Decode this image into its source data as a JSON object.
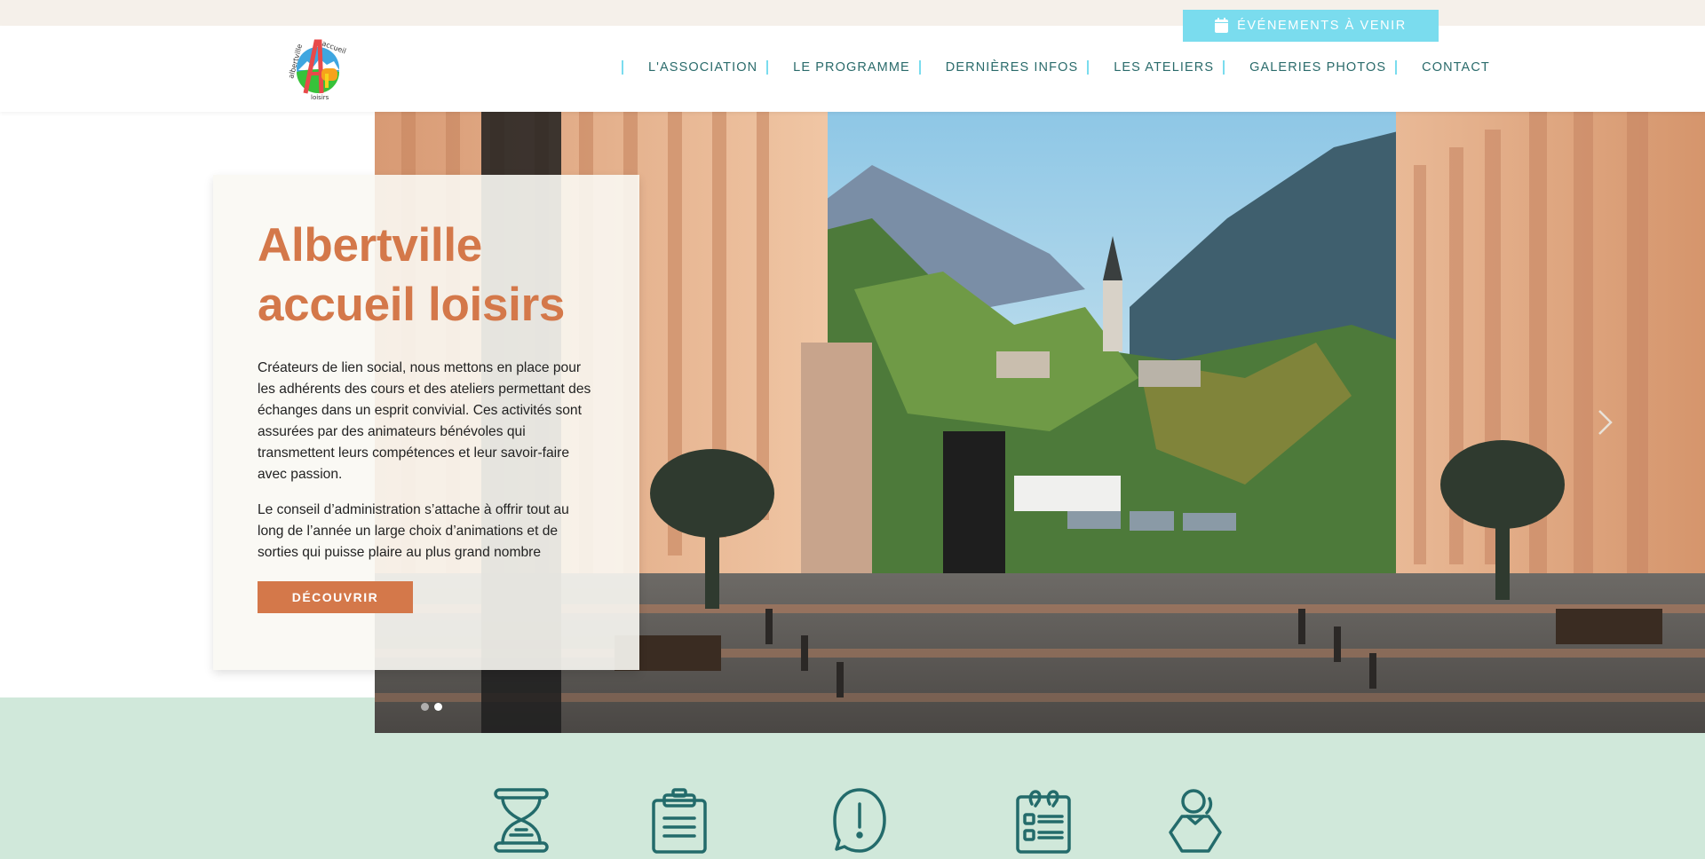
{
  "topbar": {
    "events_button": {
      "label": "Événements à venir",
      "icon": "calendar-icon"
    }
  },
  "header": {
    "logo": {
      "alt": "Albertville accueil loisirs",
      "text_top": "accueil",
      "text_left": "albertville",
      "text_bottom": "loisirs"
    },
    "nav": [
      {
        "label": "L'Association"
      },
      {
        "label": "Le Programme"
      },
      {
        "label": "Dernières infos"
      },
      {
        "label": "Les Ateliers"
      },
      {
        "label": "Galeries photos"
      },
      {
        "label": "Contact"
      }
    ]
  },
  "hero": {
    "title_line1": "Albertville",
    "title_line2": "accueil loisirs",
    "paragraph1": "Créateurs de lien social, nous mettons en place pour les adhérents des cours et des ateliers permettant des échanges dans un esprit convivial. Ces activités sont assurées par des animateurs bénévoles qui transmettent leurs compétences et leur savoir-faire avec passion.",
    "paragraph2": "Le conseil d’administration s’attache à offrir tout au long de l’année un large choix d’animations et de sorties qui puisse plaire au plus grand nombre",
    "cta_label": "Découvrir",
    "slider": {
      "slides": 2,
      "active_index": 1
    },
    "photo_subject": "Albertville street with arcades, mountains and church"
  },
  "features": {
    "icons": [
      {
        "name": "hourglass-icon"
      },
      {
        "name": "clipboard-icon"
      },
      {
        "name": "speech-bubble-exclamation-icon"
      },
      {
        "name": "checklist-notepad-icon"
      },
      {
        "name": "user-icon"
      }
    ]
  },
  "colors": {
    "accent_orange": "#d4784a",
    "accent_cyan": "#7adcee",
    "nav_text": "#2a6b6b",
    "icon_teal": "#236b6b",
    "mint_bg": "#d0e8da",
    "topbar_bg": "#f5f0ea"
  }
}
